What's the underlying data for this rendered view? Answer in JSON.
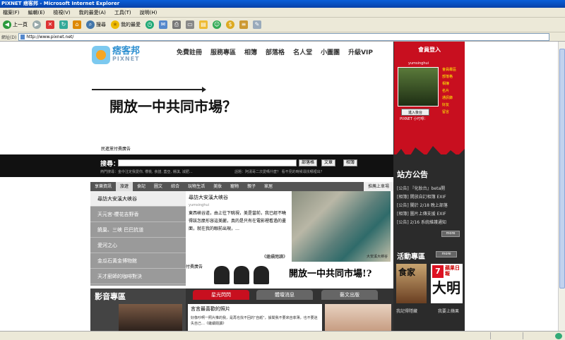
{
  "window": {
    "title": "PIXNET 痞客邦 - Microsoft Internet Explorer"
  },
  "menu": [
    "檔案(F)",
    "編輯(E)",
    "檢視(V)",
    "我的最愛(A)",
    "工具(T)",
    "說明(H)"
  ],
  "toolbar": {
    "back": "上一頁",
    "search": "搜尋",
    "favorites": "我的最愛"
  },
  "address": {
    "label": "網址(D)",
    "url": "http://www.pixnet.net/"
  },
  "site": {
    "logo_cn": "痞客邦",
    "logo_en": "PIXNET",
    "nav": [
      "免費註冊",
      "服務專區",
      "相簿",
      "部落格",
      "名人堂",
      "小圖團",
      "升級VIP"
    ],
    "banner_title": "開放一中共同市場？",
    "ad_label": "民進黨付費廣告"
  },
  "search": {
    "label": "搜尋：",
    "buttons": [
      "部落格",
      "文章",
      "相簿"
    ],
    "hint_left": "熱門搜尋：金中注定我愛你, 櫻桃, 食譜, 蓋亞, 楊淇, 減肥...",
    "hint_right": "話題：阿湯哥二次愛嗎什麼？  看不見的時候尋找哪裡出？"
  },
  "tabs": {
    "items": [
      "享樂資訊",
      "旅遊",
      "食記",
      "圖文",
      "綜合",
      "玩物生活",
      "美妝",
      "寵物",
      "親子",
      "家居"
    ],
    "active": "旅遊",
    "hot": "推薦上車場"
  },
  "sidelist": [
    "尋訪大安溪大峽谷",
    "天元宮-櫻花吉野香",
    "饒巢、三峽 巴巴抗道",
    "愛河之心",
    "金瓜石黃金博物館",
    "天才廚師的咖啡對決"
  ],
  "article": {
    "title": "尋訪大安溪大峽谷",
    "author": "yumsinghui",
    "body": "東西峽谷道，由上往下眺視，美是當前，我已經不曉得該怎麼形容這美麗，真的是只有在電影裡看過的畫面，就在我的眼前出現，…",
    "more": "《繼續閱讀》",
    "photo_caption": "大安溪大峽谷"
  },
  "adstrip": {
    "label": "付費廣告",
    "title": "開放一中共同市場!?"
  },
  "video": {
    "title": "影音專區"
  },
  "news": {
    "tabs": [
      "星光閃閃",
      "體壇消息",
      "藝文出版"
    ],
    "headline": "言言最喜歡的照片",
    "body": "好像吵啊一照片推的我，是再也找不回的\"自紙\"，據聞我不要來自菲薄，也不要迷失自己…",
    "more": "《繼續閱讀》"
  },
  "sidebar": {
    "login_title": "會員登入",
    "username": "yumsinghui",
    "links": [
      "會員專區",
      "部落格",
      "相簿",
      "名片",
      "通訊錄",
      "好友",
      "留言"
    ],
    "enter_button": "進入後台",
    "pixnet_link": "PIXNET 小叮嚀：",
    "announce_title": "站方公告",
    "announcements": [
      "[公告] 『化妝台』beta開",
      "[相簿] 開放自訂相簿 EXIF",
      "[公告] 關於 2/18 晚上部落",
      "[相簿] 圖片上傳支援 EXIF",
      "[公告] 2/16 系統維護通知"
    ],
    "announce_more": "more",
    "events_title": "活動專區",
    "events_more": "more",
    "event_1_caption": "我記得隱藏",
    "event_2_caption": "我要上蘋果",
    "event_1_text": "食家",
    "event_2_text": "大明",
    "event_2_small": "蘋果日報",
    "event_2_seven": "7"
  },
  "colors": {
    "brand": "#c80f1f",
    "dark": "#2b2b2b",
    "tabbar": "#555555"
  }
}
